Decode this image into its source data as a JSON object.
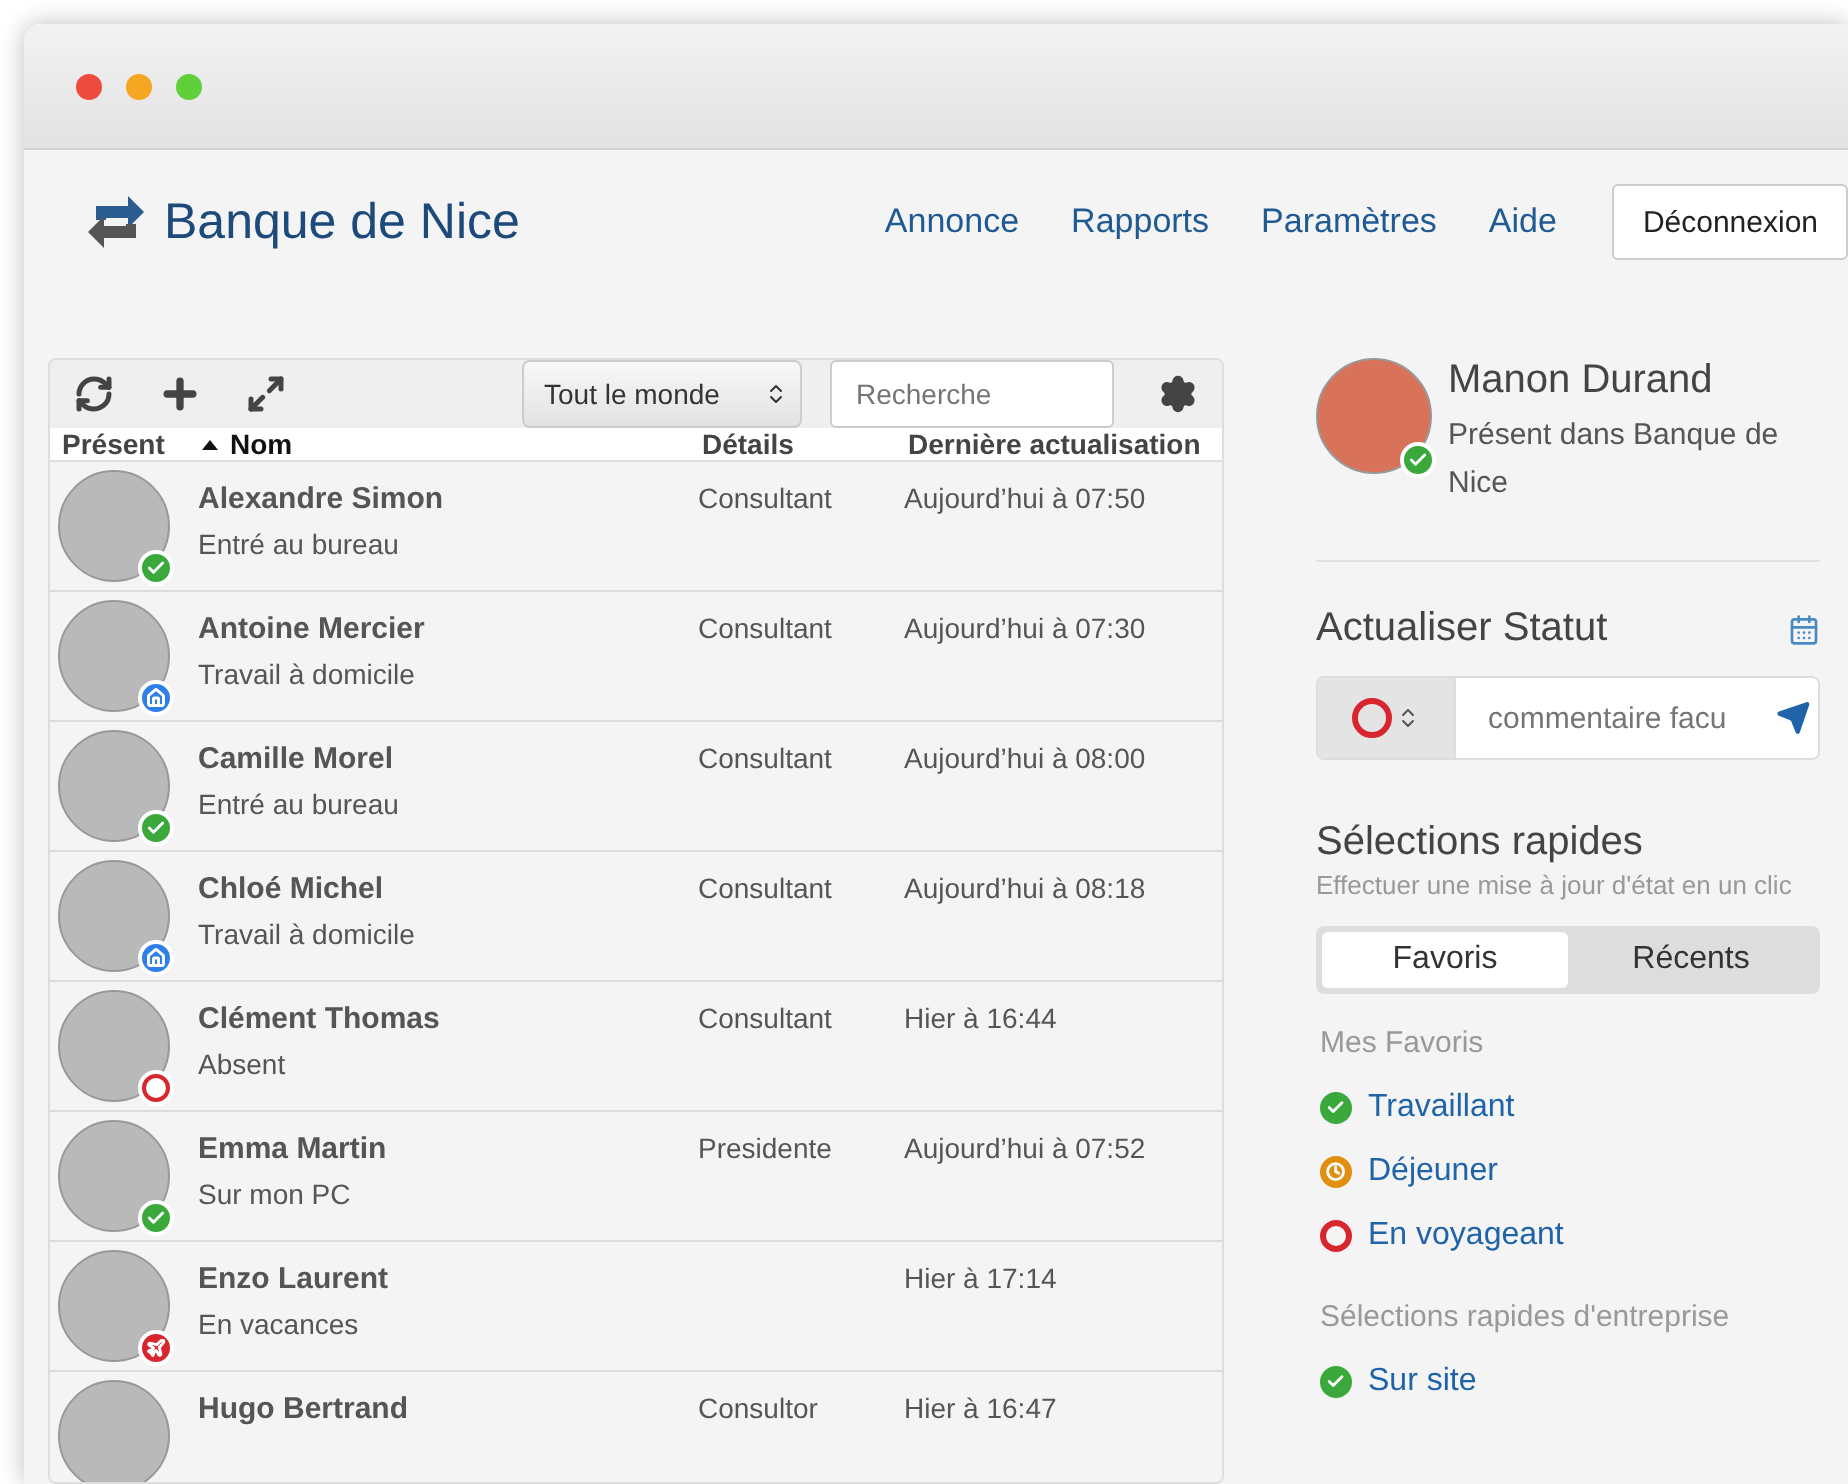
{
  "app": {
    "name": "Banque de Nice"
  },
  "nav": [
    "Annonce",
    "Rapports",
    "Paramètres",
    "Aide"
  ],
  "logout": "Déconnexion",
  "toolbar": {
    "filter": "Tout le monde",
    "search_placeholder": "Recherche"
  },
  "table": {
    "columns": [
      {
        "label": "Présent",
        "sorted": false
      },
      {
        "label": "Nom",
        "sorted": true
      },
      {
        "label": "Détails",
        "sorted": false
      },
      {
        "label": "Dernière actualisation",
        "sorted": false
      }
    ],
    "rows": [
      {
        "name": "Alexandre Simon",
        "status_text": "Entré au bureau",
        "kind": "in",
        "details": "Consultant",
        "updated": "Aujourd’hui à 07:50"
      },
      {
        "name": "Antoine Mercier",
        "status_text": "Travail à domicile",
        "kind": "home",
        "details": "Consultant",
        "updated": "Aujourd’hui à 07:30"
      },
      {
        "name": "Camille Morel",
        "status_text": "Entré au bureau",
        "kind": "in",
        "details": "Consultant",
        "updated": "Aujourd’hui à 08:00"
      },
      {
        "name": "Chloé Michel",
        "status_text": "Travail à domicile",
        "kind": "home",
        "details": "Consultant",
        "updated": "Aujourd’hui à 08:18"
      },
      {
        "name": "Clément Thomas",
        "status_text": "Absent",
        "kind": "out",
        "details": "Consultant",
        "updated": "Hier à 16:44"
      },
      {
        "name": "Emma Martin",
        "status_text": "Sur mon PC",
        "kind": "in",
        "details": "Presidente",
        "updated": "Aujourd’hui à 07:52"
      },
      {
        "name": "Enzo Laurent",
        "status_text": "En vacances",
        "kind": "travel",
        "updated": "Hier à 17:14"
      },
      {
        "name": "Hugo Bertrand",
        "details": "Consultor",
        "updated": "Hier à 16:47"
      }
    ]
  },
  "profile": {
    "name": "Manon Durand",
    "kind": "in",
    "status_text": "Présent dans Banque de Nice"
  },
  "update_status": {
    "title": "Actualiser Statut",
    "kind": "out",
    "placeholder": "commentaire facu"
  },
  "quick": {
    "title": "Sélections rapides",
    "subtitle": "Effectuer une mise à jour d'état en un clic",
    "tabs": [
      {
        "label": "Favoris",
        "selected": true
      },
      {
        "label": "Récents",
        "selected": false
      }
    ],
    "favorites_title": "Mes Favoris",
    "favorites": [
      {
        "label": "Travaillant",
        "kind": "in"
      },
      {
        "label": "Déjeuner",
        "kind": "lunch"
      },
      {
        "label": "En voyageant",
        "kind": "out"
      }
    ],
    "company_title": "Sélections rapides d'entreprise",
    "company": [
      {
        "label": "Sur site",
        "kind": "in"
      }
    ]
  }
}
